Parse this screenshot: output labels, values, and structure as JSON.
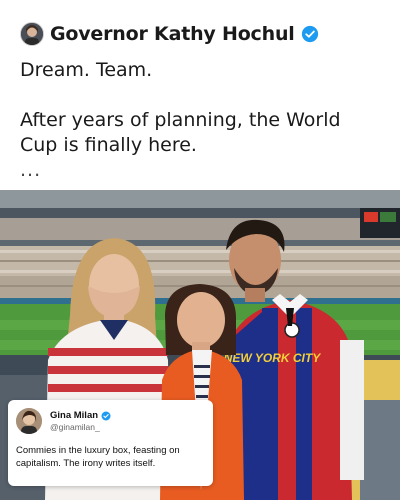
{
  "post": {
    "author": "Governor Kathy Hochul",
    "line1": "Dream. Team.",
    "line2": "After years of planning, the World Cup is finally here.",
    "more": "..."
  },
  "photo": {
    "jersey_text": "NEW YORK CITY"
  },
  "quote": {
    "name": "Gina Milan",
    "handle": "@ginamilan_",
    "text": "Commies in the luxury box, feasting on capitalism. The irony writes itself."
  },
  "colors": {
    "verified_blue": "#1d9bf0",
    "text": "#1a1a1a"
  }
}
